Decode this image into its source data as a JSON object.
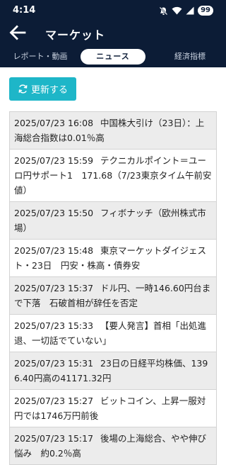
{
  "status": {
    "time": "4:14",
    "battery": "99"
  },
  "header": {
    "title": "マーケット"
  },
  "tabs": [
    {
      "label": "レポート・動画"
    },
    {
      "label": "ニュース"
    },
    {
      "label": "経済指標"
    }
  ],
  "refresh_label": "更新する",
  "news": [
    {
      "date": "2025/07/23 16:08",
      "title": "中国株大引け（23日）：上海総合指数は0.01％高"
    },
    {
      "date": "2025/07/23 15:59",
      "title": "テクニカルポイント＝ユーロ円サポート1　171.68（7/23東京タイム午前安値）"
    },
    {
      "date": "2025/07/23 15:50",
      "title": "フィボナッチ（欧州株式市場）"
    },
    {
      "date": "2025/07/23 15:48",
      "title": "東京マーケットダイジェスト・23日　円安・株高・債券安"
    },
    {
      "date": "2025/07/23 15:37",
      "title": "ドル円、一時146.60円台まで下落　石破首相が辞任を否定"
    },
    {
      "date": "2025/07/23 15:33",
      "title": "【要人発言】首相「出処進退、一切話でていない」"
    },
    {
      "date": "2025/07/23 15:31",
      "title": "23日の日経平均株価、1396.40円高の41171.32円"
    },
    {
      "date": "2025/07/23 15:27",
      "title": "ビットコイン、上昇一服対円では1746万円前後"
    },
    {
      "date": "2025/07/23 15:17",
      "title": "後場の上海総合、やや伸び悩み　約0.2％高"
    }
  ]
}
